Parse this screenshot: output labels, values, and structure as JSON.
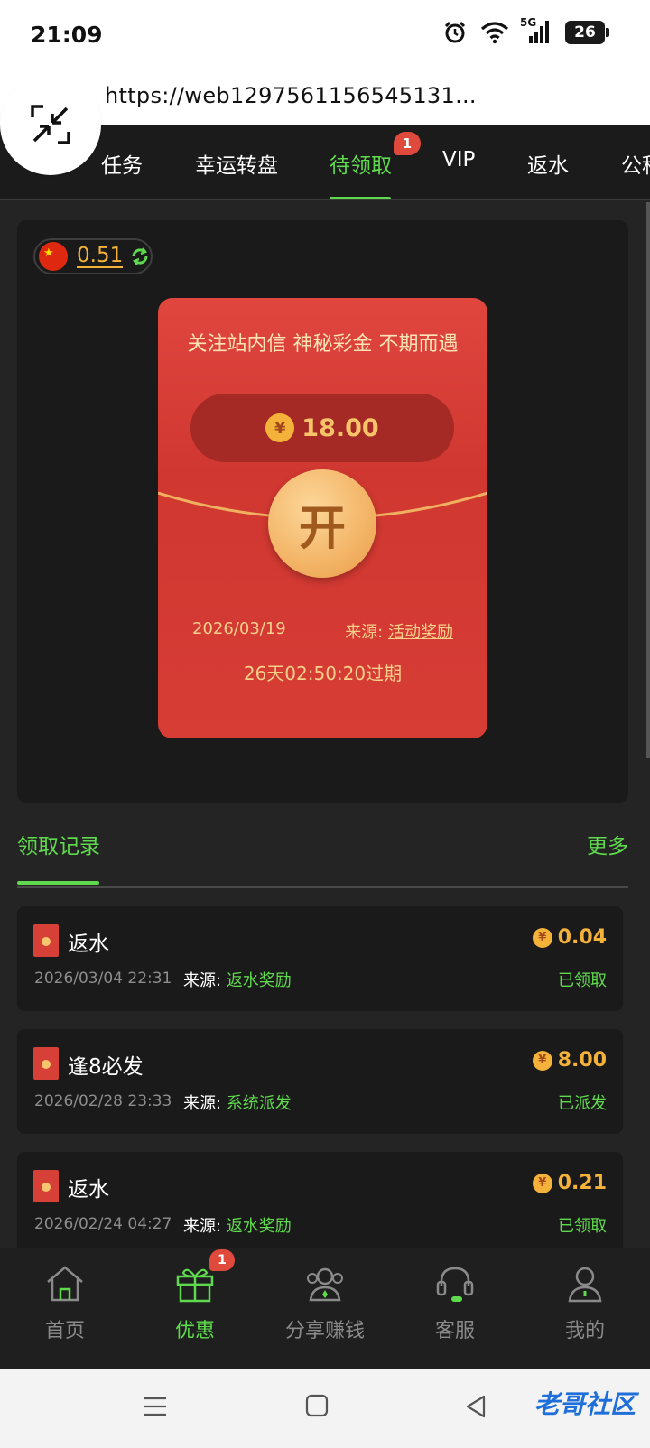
{
  "status_bar": {
    "time": "21:09",
    "network": "5G",
    "battery": "26"
  },
  "browser": {
    "url": "https://web1297561156545131..."
  },
  "tabs": [
    {
      "label": "任务"
    },
    {
      "label": "幸运转盘"
    },
    {
      "label": "待领取",
      "active": true,
      "badge": "1"
    },
    {
      "label": "VIP"
    },
    {
      "label": "返水"
    },
    {
      "label": "公积"
    }
  ],
  "balance": {
    "value": "0.51"
  },
  "envelope": {
    "title": "关注站内信 神秘彩金 不期而遇",
    "currency_symbol": "¥",
    "amount": "18.00",
    "open_label": "开",
    "date": "2026/03/19",
    "source_label": "来源:",
    "source_value": "活动奖励",
    "expiry": "26天02:50:20过期"
  },
  "records_section": {
    "title": "领取记录",
    "more": "更多"
  },
  "records": [
    {
      "name": "返水",
      "amount": "0.04",
      "time": "2026/03/04 22:31",
      "source_label": "来源:",
      "source": "返水奖励",
      "status": "已领取"
    },
    {
      "name": "逢8必发",
      "amount": "8.00",
      "time": "2026/02/28 23:33",
      "source_label": "来源:",
      "source": "系统派发",
      "status": "已派发"
    },
    {
      "name": "返水",
      "amount": "0.21",
      "time": "2026/02/24 04:27",
      "source_label": "来源:",
      "source": "返水奖励",
      "status": "已领取"
    }
  ],
  "bottom_nav": [
    {
      "label": "首页",
      "icon": "home-icon"
    },
    {
      "label": "优惠",
      "icon": "gift-icon",
      "active": true,
      "badge": "1"
    },
    {
      "label": "分享赚钱",
      "icon": "share-earn-icon"
    },
    {
      "label": "客服",
      "icon": "headset-icon"
    },
    {
      "label": "我的",
      "icon": "user-icon"
    }
  ],
  "watermark": "老哥社区",
  "colors": {
    "accent": "#5fd94d",
    "gold": "#f4b23a",
    "envelope_red": "#d73d35",
    "badge_red": "#e04a3c"
  }
}
